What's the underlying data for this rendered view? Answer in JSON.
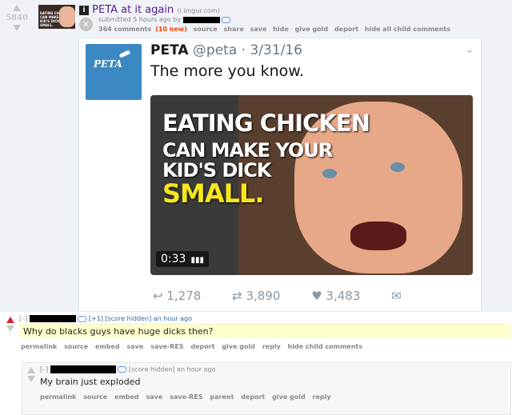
{
  "post": {
    "score": "5840",
    "flair": "i",
    "title": "PETA at it again",
    "domain": "(i.imgur.com)",
    "submitted": "submitted 5 hours ago by",
    "links": [
      "364 comments",
      "(10 new)",
      "source",
      "share",
      "save",
      "hide",
      "give gold",
      "deport",
      "hide all child comments"
    ]
  },
  "thumbnail": {
    "text": "EATING CHICKEN CAN MAKE YOUR KID'S DICK SMALL."
  },
  "tweet": {
    "name": "PETA",
    "handle": "@peta · 3/31/16",
    "text": "The more you know.",
    "logo_text": "PETA",
    "video_lines": [
      "EATING CHICKEN",
      "CAN MAKE YOUR",
      "KID'S DICK",
      "SMALL."
    ],
    "duration": "0:33",
    "replies": "1,278",
    "retweets": "3,890",
    "likes": "3,483"
  },
  "comment1": {
    "toggle": "[–]",
    "score": "[+1] [score hidden] an hour ago",
    "body": "Why do blacks guys have huge dicks then?",
    "links": [
      "permalink",
      "source",
      "embed",
      "save",
      "save-RES",
      "deport",
      "give gold",
      "reply",
      "hide child comments"
    ]
  },
  "comment2": {
    "toggle": "[–]",
    "score": "[score hidden] an hour ago",
    "body": "My brain just exploded",
    "links": [
      "permalink",
      "source",
      "embed",
      "save",
      "save-RES",
      "parent",
      "deport",
      "give gold",
      "reply"
    ]
  },
  "colors": {
    "title": "#551a8b",
    "highlight": "#ffffcc",
    "upvote": "#d1262a",
    "twitter_gray": "#8899a6"
  }
}
